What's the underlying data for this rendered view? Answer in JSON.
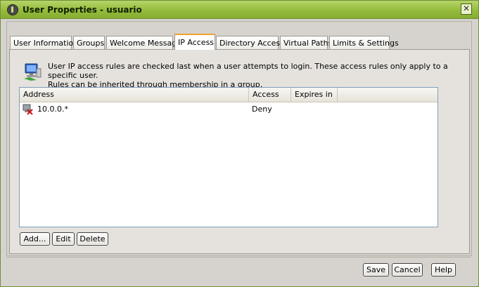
{
  "window": {
    "title": "User Properties - usuario",
    "close_glyph": "✕"
  },
  "tabs": [
    {
      "label": "User Information",
      "active": false
    },
    {
      "label": "Groups",
      "active": false
    },
    {
      "label": "Welcome Message",
      "active": false
    },
    {
      "label": "IP Access",
      "active": true
    },
    {
      "label": "Directory Access",
      "active": false
    },
    {
      "label": "Virtual Paths",
      "active": false
    },
    {
      "label": "Limits & Settings",
      "active": false
    }
  ],
  "ip_access": {
    "info_icon": "network-computer-icon",
    "description_line1": "User IP access rules are checked last when a user attempts to login. These access rules only apply to a specific user.",
    "description_line2": "Rules can be inherited through membership in a group.",
    "columns": [
      "Address",
      "Access",
      "Expires in"
    ],
    "rows": [
      {
        "icon": "deny-rule-icon",
        "address": "10.0.0.*",
        "access": "Deny",
        "expires": ""
      }
    ],
    "buttons": {
      "add": "Add...",
      "edit": "Edit",
      "delete": "Delete"
    }
  },
  "footer": {
    "save": "Save",
    "cancel": "Cancel",
    "help": "Help"
  },
  "colors": {
    "titlebar": "#95bc3c",
    "active_tab_accent": "#f0a030",
    "grid_border": "#7f9db9",
    "deny_mark": "#d01010"
  }
}
